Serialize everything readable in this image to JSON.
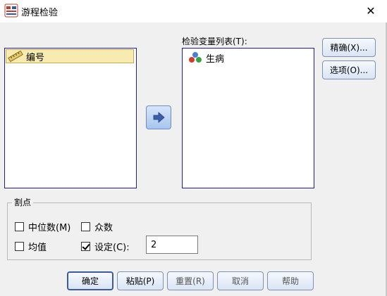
{
  "window": {
    "title": "游程检验"
  },
  "source_list": {
    "items": [
      {
        "label": "编号",
        "icon": "ruler-scale-icon"
      }
    ]
  },
  "target_list": {
    "label": "检验变量列表(T):",
    "items": [
      {
        "label": "生病",
        "icon": "nominal-balls-icon"
      }
    ]
  },
  "side_buttons": {
    "exact": "精确(X)...",
    "options": "选项(O)..."
  },
  "cutpoint": {
    "title": "割点",
    "median": {
      "label": "中位数(M)",
      "checked": false
    },
    "mode": {
      "label": "众数",
      "checked": false
    },
    "mean": {
      "label": "均值",
      "checked": false
    },
    "custom": {
      "label": "设定(C):",
      "checked": true,
      "value": "2"
    }
  },
  "buttons": {
    "ok": "确定",
    "paste": "粘贴(P)",
    "reset": "重置(R)",
    "cancel": "取消",
    "help": "帮助"
  },
  "colors": {
    "list_border": "#1e1e96",
    "selected_item_bg": "#f7ebb1",
    "dialog_bg": "#f0f0f0"
  }
}
